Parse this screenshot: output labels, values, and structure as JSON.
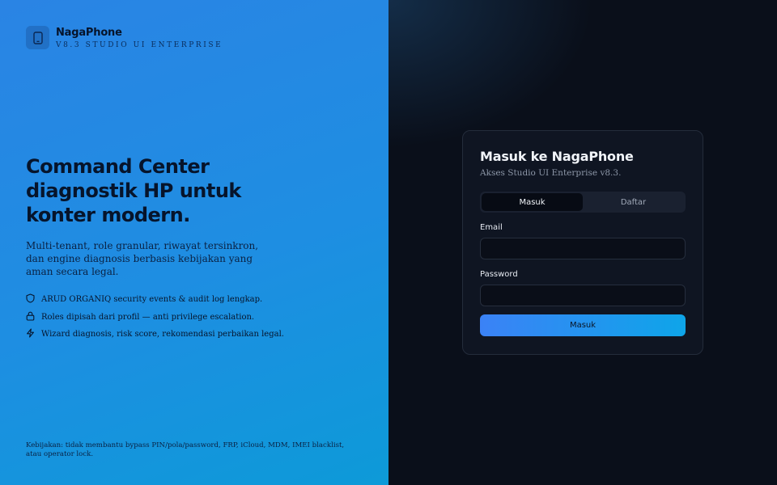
{
  "brand": {
    "name": "NagaPhone",
    "subtitle": "V8.3 STUDIO UI ENTERPRISE",
    "icon": "phone-icon"
  },
  "hero": {
    "title": "Command Center diagnostik HP untuk konter modern.",
    "description": "Multi-tenant, role granular, riwayat tersinkron, dan engine diagnosis berbasis kebijakan yang aman secara legal."
  },
  "features": [
    {
      "icon": "shield-icon",
      "text": "ARUD ORGANIQ security events & audit log lengkap."
    },
    {
      "icon": "lock-icon",
      "text": "Roles dipisah dari profil — anti privilege escalation."
    },
    {
      "icon": "lightning-icon",
      "text": "Wizard diagnosis, risk score, rekomendasi perbaikan legal."
    }
  ],
  "policy": "Kebijakan: tidak membantu bypass PIN/pola/password, FRP, iCloud, MDM, IMEI blacklist, atau operator lock.",
  "login": {
    "title": "Masuk ke NagaPhone",
    "subtitle": "Akses Studio UI Enterprise v8.3.",
    "tabs": [
      {
        "label": "Masuk",
        "active": true
      },
      {
        "label": "Daftar",
        "active": false
      }
    ],
    "email_label": "Email",
    "email_value": "",
    "password_label": "Password",
    "password_value": "",
    "submit_label": "Masuk"
  },
  "colors": {
    "left_gradient_start": "#2a84e4",
    "left_gradient_end": "#0d9ad8",
    "right_background": "#0a0f1a",
    "card_background": "#0f1522",
    "button_gradient_start": "#3b82f6",
    "button_gradient_end": "#0ea5e9"
  }
}
